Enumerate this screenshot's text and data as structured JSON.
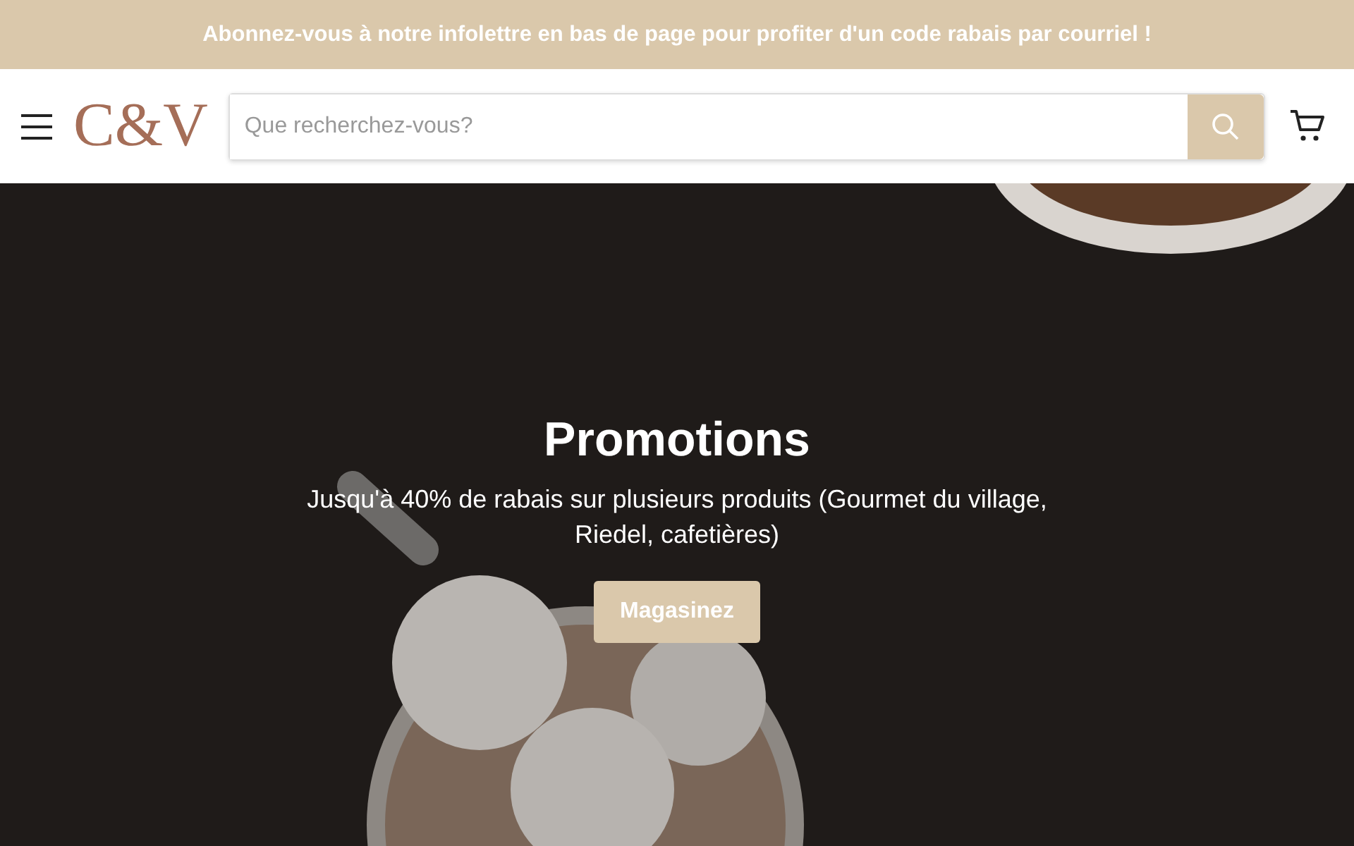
{
  "announcement": "Abonnez-vous à notre infolettre en bas de page pour profiter d'un code rabais par courriel !",
  "header": {
    "logo": "C&V",
    "search": {
      "placeholder": "Que recherchez-vous?"
    }
  },
  "hero": {
    "title": "Promotions",
    "text": "Jusqu'à 40% de rabais sur plusieurs produits (Gourmet du village, Riedel, cafetières)",
    "button": "Magasinez"
  }
}
